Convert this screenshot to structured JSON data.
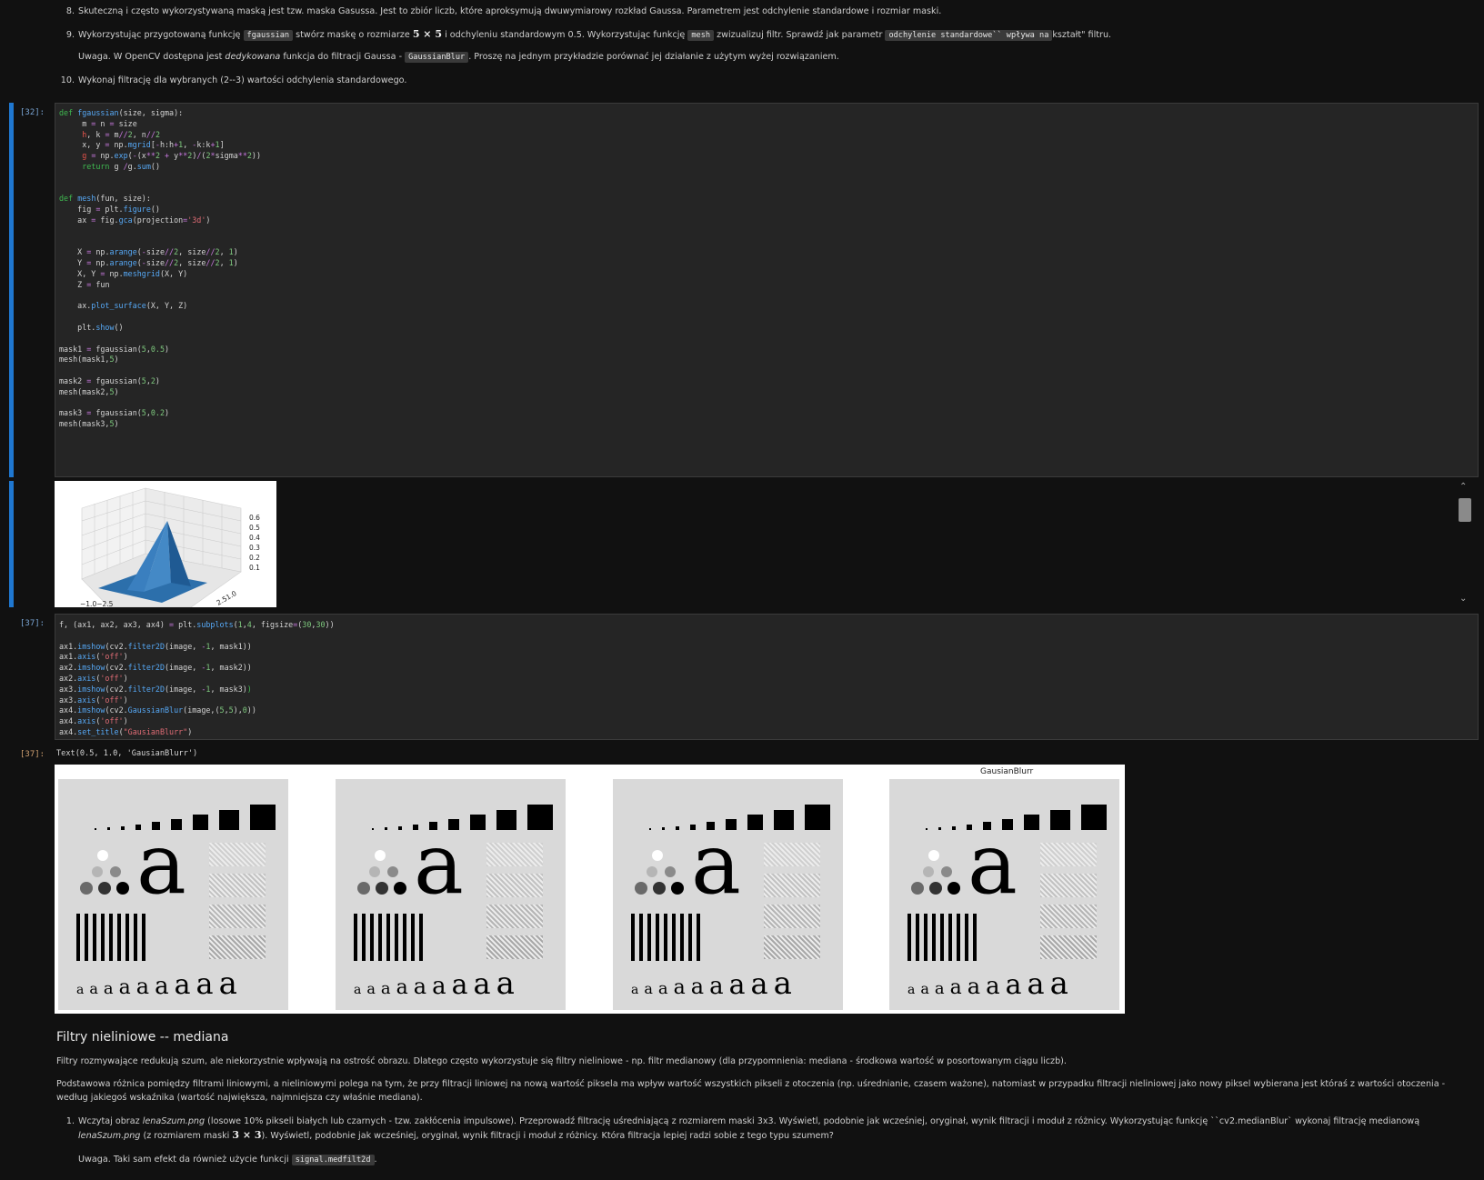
{
  "md_top": {
    "item8": {
      "num": "8.",
      "text": "Skuteczną i często wykorzystywaną maską jest tzw. maska Gasussa. Jest to zbiór liczb, które aproksymują dwuwymiarowy rozkład Gaussa. Parametrem jest odchylenie standardowe i rozmiar maski."
    },
    "item9": {
      "num": "9.",
      "p1": "Wykorzystując przygotowaną funkcję",
      "code1": "fgaussian",
      "p2": "stwórz maskę o rozmiarze",
      "math": "5 × 5",
      "p3": "i odchyleniu standardowym 0.5. Wykorzystując funkcję",
      "code2": "mesh",
      "p4": "zwizualizuj filtr. Sprawdź jak parametr",
      "code3": "odchylenie standardowe`` wpływa na",
      "p5": "kształt\" filtru."
    },
    "uwaga1": {
      "p1": "Uwaga. W OpenCV dostępna jest",
      "em": "dedykowana",
      "p2": "funkcja do filtracji Gaussa -",
      "code": "GaussianBlur",
      "p3": ". Proszę na jednym przykładzie porównać jej działanie z użytym wyżej rozwiązaniem."
    },
    "item10": {
      "num": "10.",
      "text": "Wykonaj filtrację dla wybranych (2--3) wartości odchylenia standardowego."
    }
  },
  "cell32": {
    "prompt": "[32]:"
  },
  "cell37": {
    "prompt": "[37]:"
  },
  "out37": {
    "prompt": "[37]:",
    "text": "Text(0.5, 1.0, 'GausianBlurr')"
  },
  "plot3d": {
    "zticks": [
      "0.6",
      "0.5",
      "0.4",
      "0.3",
      "0.2",
      "0.1"
    ],
    "xlabel_partial": "−1.0−2.5",
    "ylabel_partial": "2.51.0"
  },
  "figure": {
    "panel_title": "GausianBlurr",
    "glyph_large": "a",
    "bottom_row": "a a a a a a a a a"
  },
  "md_bottom": {
    "heading": "Filtry nieliniowe -- mediana",
    "p1": "Filtry rozmywające redukują szum, ale niekorzystnie wpływają na ostrość obrazu. Dlatego często wykorzystuje się filtry nieliniowe - np. filtr medianowy (dla przypomnienia: mediana - środkowa wartość w posortowanym ciągu liczb).",
    "p2": "Podstawowa różnica pomiędzy filtrami liniowymi, a nieliniowymi polega na tym, że przy filtracji liniowej na nową wartość piksela ma wpływ wartość wszystkich pikseli z otoczenia (np. uśrednianie, czasem ważone), natomiast w przypadku filtracji nieliniowej jako nowy piksel wybierana jest któraś z wartości otoczenia - według jakiegoś wskaźnika (wartość największa, najmniejsza czy właśnie mediana).",
    "item1": {
      "num": "1.",
      "a": "Wczytaj obraz",
      "em1": "lenaSzum.png",
      "b": "(losowe 10% pikseli białych lub czarnych - tzw. zakłócenia impulsowe). Przeprowadź filtrację uśredniającą z rozmiarem maski 3x3. Wyświetl, podobnie jak wcześniej, oryginał, wynik filtracji i moduł z różnicy. Wykorzystując funkcję ``cv2.medianBlur` wykonaj filtrację medianową",
      "em2": "lenaSzum.png",
      "c": "(z rozmiarem maski",
      "math": "3 × 3",
      "d": "). Wyświetl, podobnie jak wcześniej, oryginał, wynik filtracji i moduł z różnicy. Która filtracja lepiej radzi sobie z tego typu szumem?"
    },
    "uwaga2": {
      "p1": "Uwaga. Taki sam efekt da również użycie funkcji",
      "code": "signal.medfilt2d",
      "p2": "."
    }
  }
}
